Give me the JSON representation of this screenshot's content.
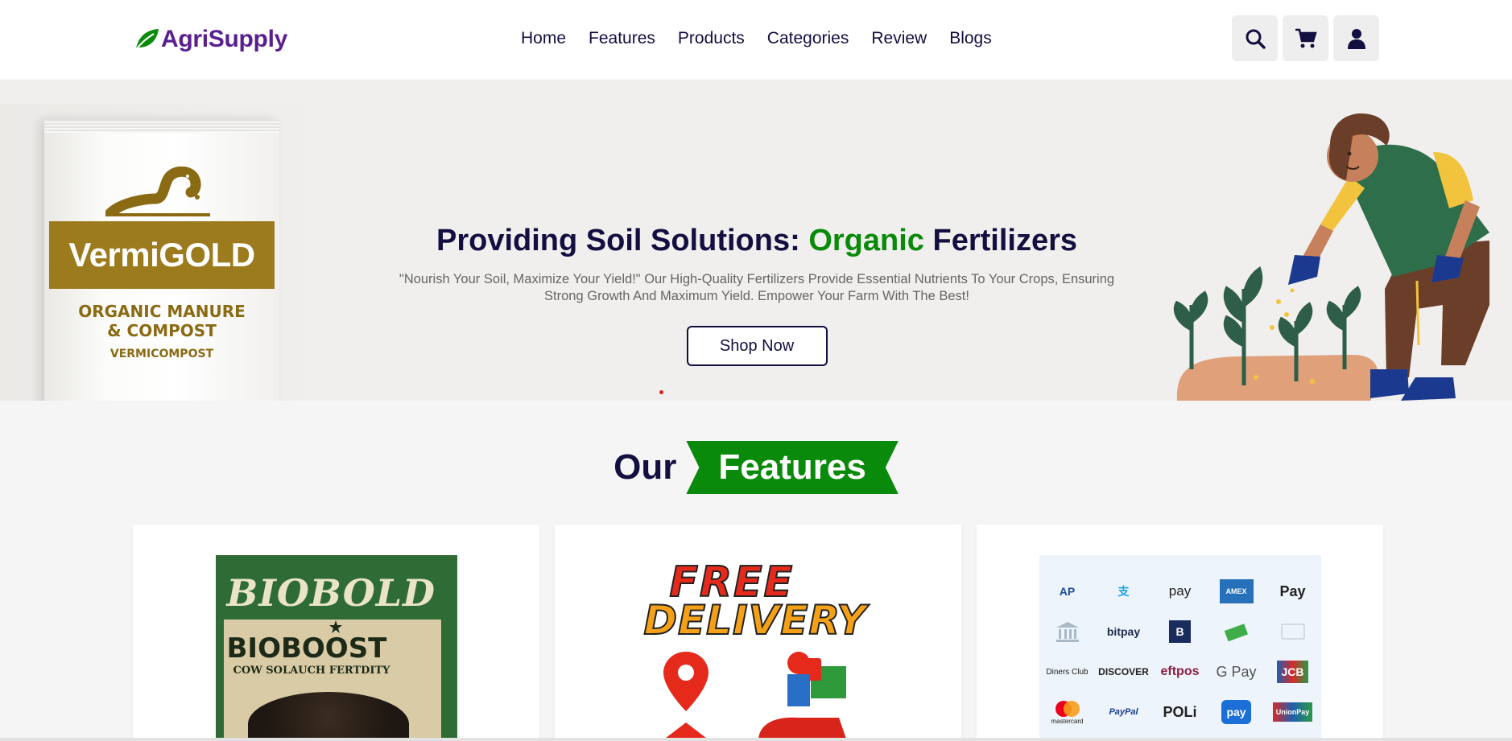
{
  "header": {
    "logo_text": "AgriSupply",
    "nav": [
      "Home",
      "Features",
      "Products",
      "Categories",
      "Review",
      "Blogs"
    ],
    "icons": [
      "search-icon",
      "cart-icon",
      "user-icon"
    ]
  },
  "hero": {
    "title_part1": "Providing Soil Solutions: ",
    "title_highlight": "Organic",
    "title_part2": " Fertilizers",
    "description": "\"Nourish Your Soil, Maximize Your Yield!\" Our High-Quality Fertilizers Provide Essential Nutrients To Your Crops, Ensuring Strong Growth And Maximum Yield. Empower Your Farm With The Best!",
    "button": "Shop Now",
    "packet": {
      "brand": "VermiGOLD",
      "line1": "ORGANIC MANURE",
      "line2": "& COMPOST",
      "line3": "VERMICOMPOST"
    }
  },
  "features": {
    "heading_plain": "Our",
    "heading_tag": "Features",
    "cards": [
      {
        "bag_top": "BIOBOLD",
        "bag_name": "BIOBOOST",
        "bag_sub": "COW SOLAUCH FERTDITY"
      },
      {
        "line1": "FREE",
        "line2": "DELIVERY"
      },
      {
        "payments": [
          "AP",
          "支",
          "pay",
          "AMEX",
          "Pay",
          "",
          "bitpay",
          "B",
          "",
          "",
          "Diners Club",
          "DISCOVER",
          "eftpos",
          "G Pay",
          "JCB",
          "mastercard",
          "PayPal",
          "POLi",
          "pay",
          "UnionPay"
        ]
      }
    ]
  },
  "colors": {
    "brand": "#5a1f8e",
    "accent_green": "#0a8a0a",
    "text_dark": "#130f40",
    "slider_dot": "#e02020"
  }
}
